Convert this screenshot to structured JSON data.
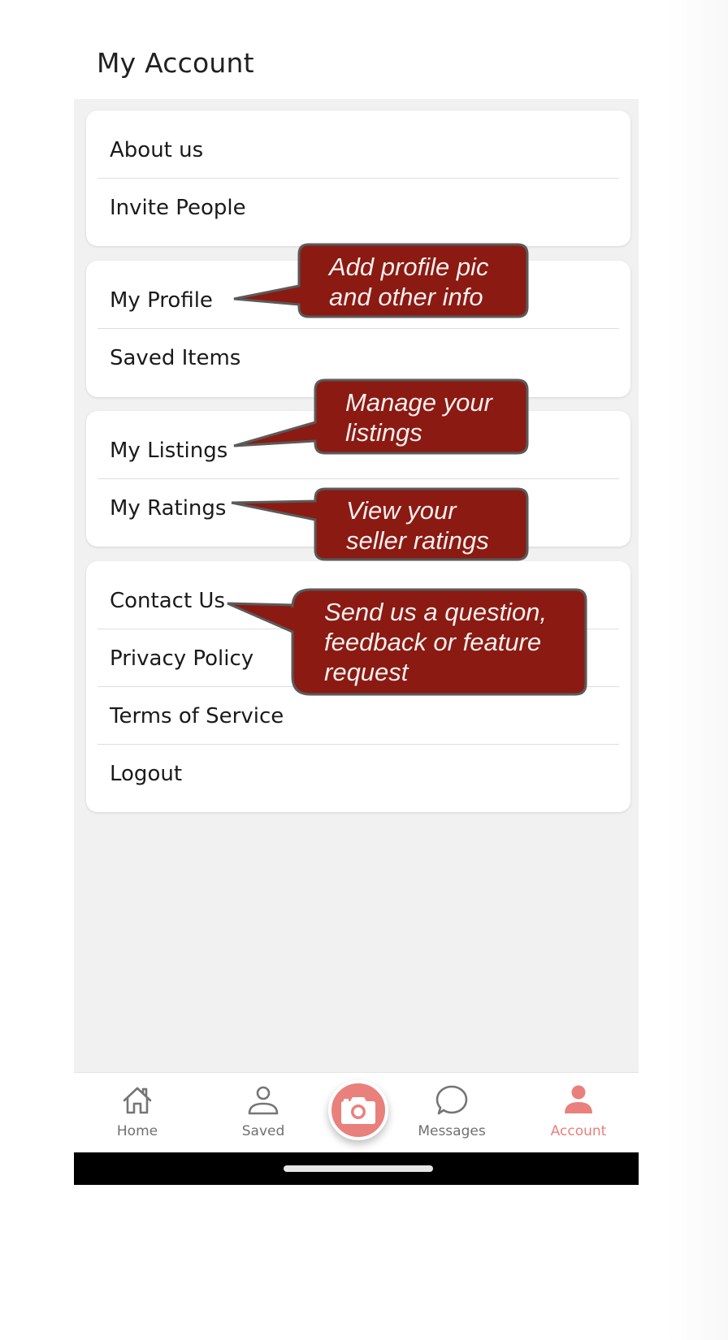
{
  "header": {
    "title": "My Account"
  },
  "menu_groups": [
    {
      "items": [
        {
          "label": "About us"
        },
        {
          "label": "Invite People"
        }
      ]
    },
    {
      "items": [
        {
          "label": "My Profile"
        },
        {
          "label": "Saved Items"
        }
      ]
    },
    {
      "items": [
        {
          "label": "My Listings"
        },
        {
          "label": "My Ratings"
        }
      ]
    },
    {
      "items": [
        {
          "label": "Contact Us"
        },
        {
          "label": "Privacy Policy"
        },
        {
          "label": "Terms of Service"
        },
        {
          "label": "Logout"
        }
      ]
    }
  ],
  "callouts": [
    {
      "target": "My Profile",
      "text": "Add profile pic\nand other info"
    },
    {
      "target": "My Listings",
      "text": "Manage your\nlistings"
    },
    {
      "target": "My Ratings",
      "text": "View your\nseller ratings"
    },
    {
      "target": "Contact Us",
      "text": "Send us a question,\nfeedback or feature\nrequest"
    }
  ],
  "bottom_nav": {
    "items": [
      {
        "label": "Home",
        "icon": "home-icon",
        "active": false
      },
      {
        "label": "Saved",
        "icon": "person-outline-icon",
        "active": false
      },
      {
        "label": "Messages",
        "icon": "chat-bubble-icon",
        "active": false
      },
      {
        "label": "Account",
        "icon": "person-filled-icon",
        "active": true
      }
    ],
    "center_button_icon": "camera-icon"
  },
  "colors": {
    "accent": "#e9807c",
    "callout_fill": "#8b1a12",
    "callout_border": "#5a5a5a",
    "background": "#f1f1f1"
  }
}
